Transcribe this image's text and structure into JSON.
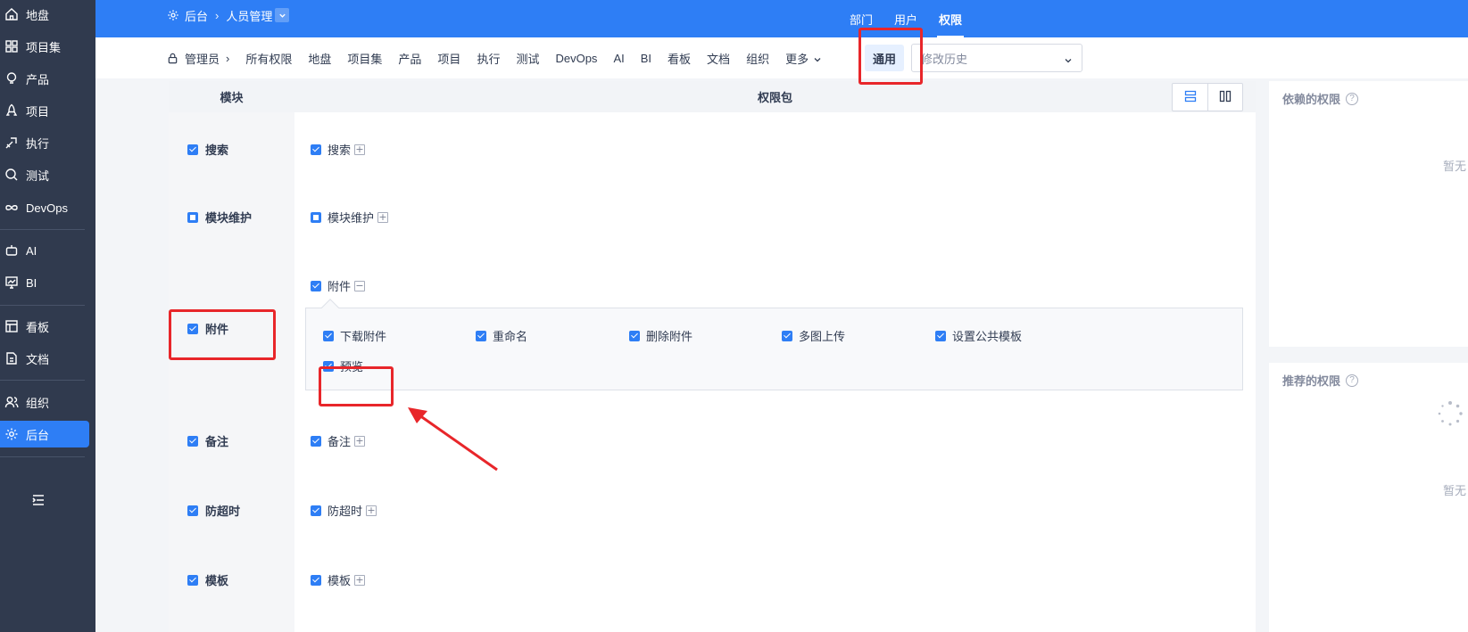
{
  "sidebar": {
    "items": [
      {
        "label": "地盘",
        "icon": "home-icon"
      },
      {
        "label": "项目集",
        "icon": "grid-icon"
      },
      {
        "label": "产品",
        "icon": "bulb-icon"
      },
      {
        "label": "项目",
        "icon": "rocket-icon"
      },
      {
        "label": "执行",
        "icon": "run-icon"
      },
      {
        "label": "测试",
        "icon": "test-icon"
      },
      {
        "label": "DevOps",
        "icon": "infinity-icon"
      },
      {
        "label": "AI",
        "icon": "robot-icon"
      },
      {
        "label": "BI",
        "icon": "chart-icon"
      },
      {
        "label": "看板",
        "icon": "kanban-icon"
      },
      {
        "label": "文档",
        "icon": "doc-icon"
      },
      {
        "label": "组织",
        "icon": "people-icon"
      },
      {
        "label": "后台",
        "icon": "gear-icon",
        "active": true
      }
    ]
  },
  "header": {
    "breadcrumb_root": "后台",
    "breadcrumb_current": "人员管理",
    "tabs": [
      "部门",
      "用户",
      "权限"
    ],
    "active_tab": "权限"
  },
  "subbar": {
    "role": "管理员",
    "items": [
      "所有权限",
      "地盘",
      "项目集",
      "产品",
      "项目",
      "执行",
      "测试",
      "DevOps",
      "AI",
      "BI",
      "看板",
      "文档",
      "组织",
      "更多"
    ],
    "active_pill": "通用",
    "history_placeholder": "修改历史"
  },
  "table": {
    "col_module": "模块",
    "col_package": "权限包",
    "rows": [
      {
        "module": "搜索",
        "package": "搜索",
        "state": "checked",
        "expand": "+"
      },
      {
        "module": "模块维护",
        "package": "模块维护",
        "state": "partial",
        "expand": "+"
      },
      {
        "module": "附件",
        "package": "附件",
        "state": "checked",
        "expand": "−"
      },
      {
        "module": "备注",
        "package": "备注",
        "state": "checked",
        "expand": "+"
      },
      {
        "module": "防超时",
        "package": "防超时",
        "state": "checked",
        "expand": "+"
      },
      {
        "module": "模板",
        "package": "模板",
        "state": "checked",
        "expand": "+"
      }
    ],
    "attachment_perms": [
      "下载附件",
      "重命名",
      "删除附件",
      "多图上传",
      "设置公共模板",
      "预览"
    ]
  },
  "right": {
    "depend_title": "依赖的权限",
    "depend_empty": "暂无",
    "recommend_title": "推荐的权限",
    "recommend_empty": "暂无"
  },
  "colors": {
    "brand": "#2e7ef5",
    "sidebar": "#303a4e",
    "highlight": "#e8262a"
  }
}
